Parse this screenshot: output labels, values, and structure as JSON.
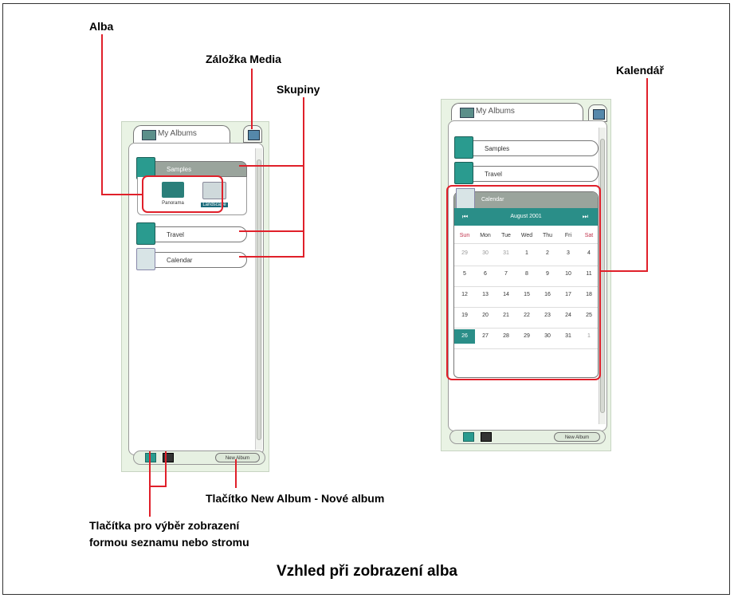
{
  "callouts": {
    "alba": "Alba",
    "media_tab": "Záložka Media",
    "groups": "Skupiny",
    "calendar": "Kalendář",
    "new_album_button": "Tlačítko New Album - Nové album",
    "view_buttons_line1": "Tlačítka pro výběr zobrazení",
    "view_buttons_line2": "formou seznamu nebo stromu"
  },
  "caption": "Vzhled při zobrazení alba",
  "left_panel": {
    "tab_label": "My Albums",
    "groups": [
      {
        "label": "Samples",
        "expanded": true
      },
      {
        "label": "Travel",
        "expanded": false
      },
      {
        "label": "Calendar",
        "expanded": false
      }
    ],
    "albums": [
      {
        "label": "Panorama",
        "selected": false
      },
      {
        "label": "Landscape",
        "selected": true
      }
    ],
    "new_album_label": "New Album"
  },
  "right_panel": {
    "tab_label": "My Albums",
    "groups": [
      {
        "label": "Samples"
      },
      {
        "label": "Travel"
      }
    ],
    "calendar_group_label": "Calendar",
    "month_label": "August 2001",
    "prev_glyph": "⏮",
    "next_glyph": "⏭",
    "weekdays": [
      "Sun",
      "Mon",
      "Tue",
      "Wed",
      "Thu",
      "Fri",
      "Sat"
    ],
    "weeks": [
      [
        "29",
        "30",
        "31",
        "1",
        "2",
        "3",
        "4"
      ],
      [
        "5",
        "6",
        "7",
        "8",
        "9",
        "10",
        "11"
      ],
      [
        "12",
        "13",
        "14",
        "15",
        "16",
        "17",
        "18"
      ],
      [
        "19",
        "20",
        "21",
        "22",
        "23",
        "24",
        "25"
      ],
      [
        "26",
        "27",
        "28",
        "29",
        "30",
        "31",
        "1"
      ]
    ],
    "today": "26",
    "new_album_label": "New Album"
  },
  "colors": {
    "accent": "#2a8e88",
    "callout_line": "#e0202a",
    "weekend": "#c0304a"
  }
}
